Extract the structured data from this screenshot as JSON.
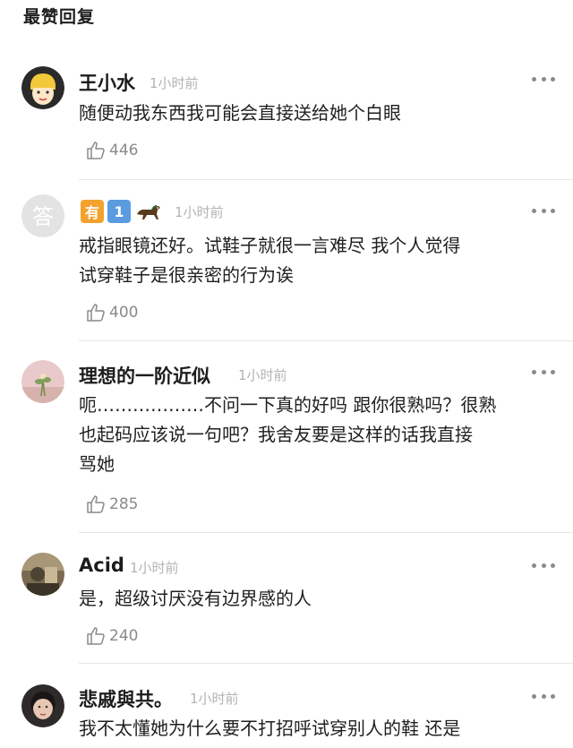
{
  "header": {
    "title": "最赞回复"
  },
  "more_label": "•••",
  "comments": [
    {
      "username": "王小水",
      "time": "1小时前",
      "lines": [
        "随便动我东西我可能会直接送给她个白眼"
      ],
      "likes": "446"
    },
    {
      "username": "",
      "badges": {
        "you": "有",
        "num": "1"
      },
      "time": "1小时前",
      "lines": [
        "戒指眼镜还好。试鞋子就很一言难尽 我个人觉得",
        "试穿鞋子是很亲密的行为诶"
      ],
      "likes": "400"
    },
    {
      "username": "理想的一阶近似",
      "time": "1小时前",
      "lines": [
        "呃………………不问一下真的好吗 跟你很熟吗？很熟",
        "也起码应该说一句吧？我舍友要是这样的话我直接",
        "骂她"
      ],
      "likes": "285"
    },
    {
      "username": "Acid",
      "time": "1小时前",
      "lines": [
        "是，超级讨厌没有边界感的人"
      ],
      "likes": "240"
    },
    {
      "username": "悲戚與共。",
      "time": "1小时前",
      "lines": [
        "我不太懂她为什么要不打招呼试穿别人的鞋 还是"
      ],
      "likes": ""
    }
  ]
}
